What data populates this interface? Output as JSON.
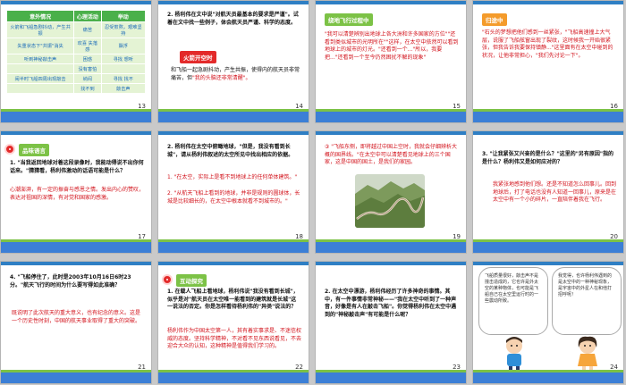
{
  "slides": [
    {
      "num": "13",
      "table": {
        "headers": [
          "意外情况",
          "心理活动",
          "举动"
        ],
        "rows": [
          [
            "火箭和飞船急剧抖动，产生共振",
            "痛苦",
            "忍受煎熬，艰难坚持"
          ],
          [
            "失重状态下\"共振\"消失",
            "欢喜 失落感",
            "飘浮"
          ],
          [
            "听到神秘敲击声",
            "困惑",
            "寻找 想听"
          ],
          [
            "",
            "没有害怕",
            ""
          ],
          [
            "闹半时飞船四周出现敲击",
            "纳闷",
            "寻找 找不"
          ],
          [
            "",
            "找不到",
            "敲击声"
          ]
        ]
      }
    },
    {
      "num": "14",
      "q": "2. 杨利伟在文中说\"对航天员最基本的要求是严谨\"。试着在文中找一些例子，体会航天员严谨、科学的态度。",
      "tag": "火箭开空时",
      "a1": "和飞船一起急剧抖动，产生共振，使得内的航天员非常痛苦，但",
      "a2": "\"我的头脑还非常清醒\"。"
    },
    {
      "num": "15",
      "tag": "绕地飞行过程中",
      "body": "\"我可以清楚辨别出地球上各大洲和许多国家的方位\"\"还看到类似城市的光明所在\"\"这样，在太空中依然可以看到地球上的城市的灯光。\"还看到一个...\"所以，我要把...\"还看到一个至今仍然困扰不解的现象\""
    },
    {
      "num": "16",
      "tag": "归途中",
      "body": "\"石头的梦想把他们感到一丝紧张，\"飞船高速撞上大气层，说服了飞船舷窗出现了裂纹，这时候我一开始很紧张，但我告诉我要保持镇静...\"这里面有在太空中碰到的状况，让他非常担心，\"我们先讨论一下\"。"
    },
    {
      "num": "17",
      "tag": "品味语言",
      "q": "1. \"当我返回地球对着这段录像时，我能动得说不出你何话来。\"猜猜看，杨利伟激动的话语可能是什么？",
      "a": "心潮澎湃，有一定的振奋与感恩之情。发出内心的赞叹，表达对祖国的深情，有对党和国家的感激。"
    },
    {
      "num": "18",
      "q": "2. 杨利伟在太空中俯瞰地球，\"但是，我没有看到长城\"，请从杨利伟叙述的太空所见中找出相应的依据。",
      "a1": "1. \"在太空，实际上是看不到地球上的任何单体建筑。\"",
      "a2": "2. \"从航天飞船上看到的地球，并非是规则的圆球体，长城是比较细长的，在太空中根本就看不到城市的。\""
    },
    {
      "num": "19",
      "q": "③ \"飞船东侧，即将越过中国上空时，我就会仔细辨析大概的国界线。\"在太空中可以清楚看见地球上的三个国家，这是中国的国土，是我们的家园。",
      "photo": "great-wall-photo"
    },
    {
      "num": "20",
      "q": "3. \"让我紧张又兴奋的是什么？\"这里的\"另有原因\"指的是什么？杨利伟又是如何应对的？",
      "a": "我紧张地感到他们想。还是不知道怎么回事儿。回到地球后，打了电话也没有人知道一回事儿，原来是在太空中有一个小的碎片，一直陪伴着我在飞行。"
    },
    {
      "num": "21",
      "q": "4. \"飞船停住了，此时是2003年10月16日6时23分。\"航天飞行的时间为什么要写得如此准确？",
      "a": "既说明了此次航天的重大意义，也有纪念的意义。这是一个历史性时刻，中国的航天事业取得了重大的突破。"
    },
    {
      "num": "22",
      "tag": "互动探究",
      "q": "1. 在载人飞船上看地球，杨利伟说\"我没有看到长城\"，似乎是对\"航天员在太空唯一能看到的建筑就是长城\"这一说法的否定。你是怎样看待杨利伟的\"异类\"说法的？",
      "a": "杨利伟作为中国太空第一人，其有着实事求是、不迷信权威的态度。坚持科学精神，不对看不见东西说看见，不去迎合大众的认知，这种精神是值得我们学习的。"
    },
    {
      "num": "23",
      "q": "2. 在太空中漂游，杨利伟经历了许多神奇的事情。其中，有一件事情非常神秘——\"我在太空中听到了一种声音，好像是有人在敲击飞船\"。你觉得杨利伟在太空中遇到的\"神秘敲击声\"有可能是什么呢？"
    },
    {
      "num": "24",
      "bubble1": "飞船质量很好，敲击声不是撞击造成的，它也许是外太空的某种物体，也可能是飞船自己在太空里运行时的一些震动所致。",
      "bubble2": "我觉得，也许杨利伟遇到的是太空中的一种神秘现象，是宇宙中的外星人在和他打招呼呢！"
    }
  ]
}
